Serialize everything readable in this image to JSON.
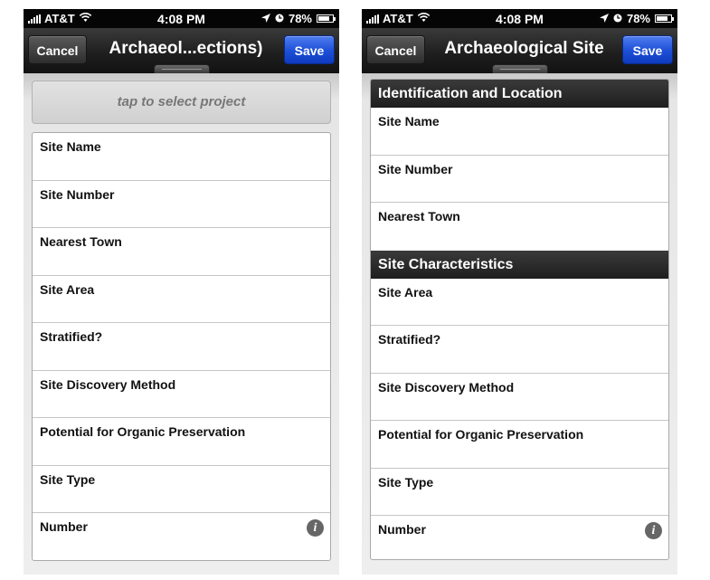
{
  "left": {
    "status": {
      "carrier": "AT&T",
      "time": "4:08 PM",
      "battery": "78%",
      "battery_level": 0.78
    },
    "nav": {
      "cancel": "Cancel",
      "title": "Archaeol...ections)",
      "save": "Save"
    },
    "project_button": "tap to select project",
    "fields": [
      "Site Name",
      "Site Number",
      "Nearest Town",
      "Site Area",
      "Stratified?",
      "Site Discovery Method",
      "Potential for Organic Preservation",
      "Site Type",
      "Number"
    ],
    "info_icon": "i"
  },
  "right": {
    "status": {
      "carrier": "AT&T",
      "time": "4:08 PM",
      "battery": "78%",
      "battery_level": 0.78
    },
    "nav": {
      "cancel": "Cancel",
      "title": "Archaeological Site",
      "save": "Save"
    },
    "sections": [
      {
        "title": "Identification and Location",
        "fields": [
          "Site Name",
          "Site Number",
          "Nearest Town"
        ]
      },
      {
        "title": "Site Characteristics",
        "fields": [
          "Site Area",
          "Stratified?",
          "Site Discovery Method",
          "Potential for Organic Preservation",
          "Site Type",
          "Number"
        ]
      }
    ],
    "info_icon": "i"
  },
  "colors": {
    "save_blue": "#1d4fd6",
    "navbar_dark": "#1f1f1f",
    "section_header": "#2a2a2a"
  }
}
